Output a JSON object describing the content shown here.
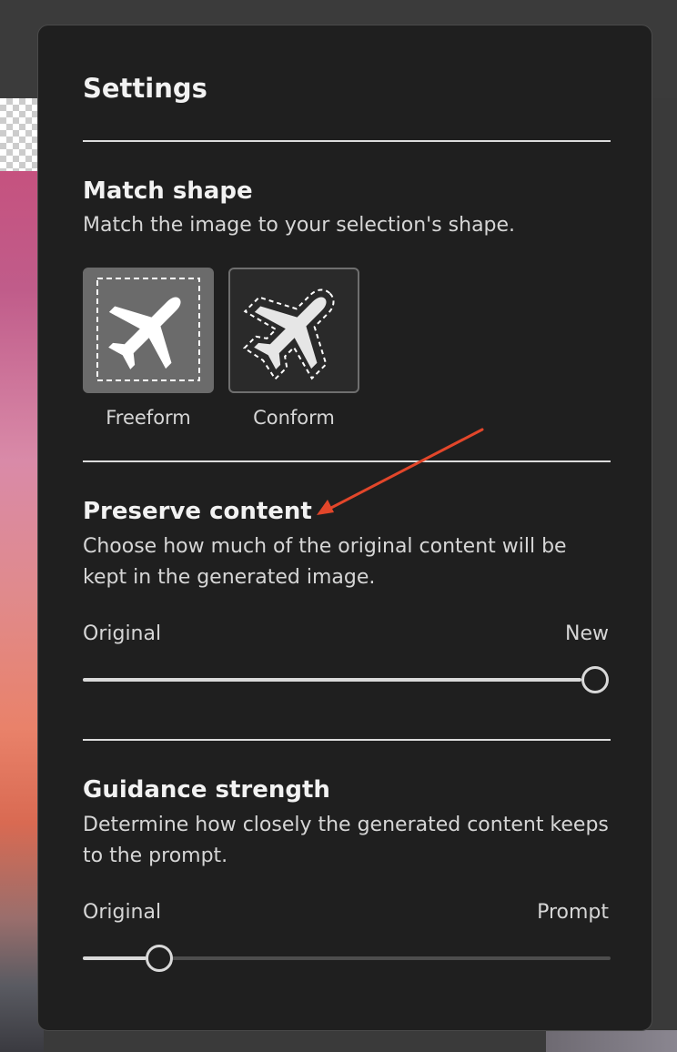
{
  "panel": {
    "title": "Settings",
    "match_shape": {
      "title": "Match shape",
      "description": "Match the image to your selection's shape.",
      "options": [
        {
          "label": "Freeform",
          "icon": "airplane-icon",
          "selected": true
        },
        {
          "label": "Conform",
          "icon": "airplane-icon",
          "selected": false
        }
      ]
    },
    "preserve_content": {
      "title": "Preserve content",
      "description": "Choose how much of the original content will be kept in the generated image.",
      "min_label": "Original",
      "max_label": "New",
      "value": 1.0
    },
    "guidance_strength": {
      "title": "Guidance strength",
      "description": "Determine how closely the generated content keeps to the prompt.",
      "min_label": "Original",
      "max_label": "Prompt",
      "value": 0.14
    }
  },
  "colors": {
    "panel_background": "#1f1f1f",
    "annotation_arrow": "#e2462a",
    "slider_fill": "#d9d9d9",
    "slider_track": "#4d4d4d"
  }
}
